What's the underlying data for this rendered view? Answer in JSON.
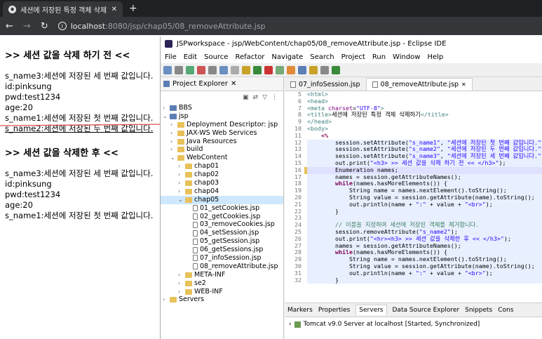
{
  "browser": {
    "tab_title": "세션에 저장된 특정 객체 삭제하",
    "url_host": "localhost",
    "url_rest": ":8080/jsp/chap05/08_removeAttribute.jsp"
  },
  "page": {
    "heading1": ">> 세션 값을 삭제 하기 전 <<",
    "before": [
      "s_name3:세션에 저장된 세 번째 값입니다.",
      "id:pinksung",
      "pwd:test1234",
      "age:20",
      "s_name1:세션에 저장된 첫 번째 값입니다.",
      "s_name2:세션에 저장된 두 번째 값입니다."
    ],
    "heading2": ">> 세션 값을 삭제한 후 <<",
    "after": [
      "s_name3:세션에 저장된 세 번째 값입니다.",
      "id:pinksung",
      "pwd:test1234",
      "age:20",
      "s_name1:세션에 저장된 첫 번째 값입니다."
    ]
  },
  "eclipse": {
    "title": "JSPworkspace - jsp/WebContent/chap05/08_removeAttribute.jsp - Eclipse IDE",
    "menu": [
      "File",
      "Edit",
      "Source",
      "Refactor",
      "Navigate",
      "Search",
      "Project",
      "Run",
      "Window",
      "Help"
    ],
    "project_explorer": "Project Explorer",
    "tree": [
      {
        "label": "BBS",
        "depth": 0,
        "type": "proj",
        "arrow": "›"
      },
      {
        "label": "jsp",
        "depth": 0,
        "type": "proj",
        "arrow": "⌄"
      },
      {
        "label": "Deployment Descriptor: jsp",
        "depth": 1,
        "type": "folder",
        "arrow": "›"
      },
      {
        "label": "JAX-WS Web Services",
        "depth": 1,
        "type": "folder",
        "arrow": "›"
      },
      {
        "label": "Java Resources",
        "depth": 1,
        "type": "folder",
        "arrow": "›"
      },
      {
        "label": "build",
        "depth": 1,
        "type": "folder",
        "arrow": "›"
      },
      {
        "label": "WebContent",
        "depth": 1,
        "type": "folder",
        "arrow": "⌄"
      },
      {
        "label": "chap01",
        "depth": 2,
        "type": "folder",
        "arrow": "›"
      },
      {
        "label": "chap02",
        "depth": 2,
        "type": "folder",
        "arrow": "›"
      },
      {
        "label": "chap03",
        "depth": 2,
        "type": "folder",
        "arrow": "›"
      },
      {
        "label": "chap04",
        "depth": 2,
        "type": "folder",
        "arrow": "›"
      },
      {
        "label": "chap05",
        "depth": 2,
        "type": "folder",
        "arrow": "⌄",
        "selected": true
      },
      {
        "label": "01_setCookies.jsp",
        "depth": 3,
        "type": "file",
        "arrow": ""
      },
      {
        "label": "02_getCookies.jsp",
        "depth": 3,
        "type": "file",
        "arrow": ""
      },
      {
        "label": "03_removeCookies.jsp",
        "depth": 3,
        "type": "file",
        "arrow": ""
      },
      {
        "label": "04_setSession.jsp",
        "depth": 3,
        "type": "file",
        "arrow": ""
      },
      {
        "label": "05_getSession.jsp",
        "depth": 3,
        "type": "file",
        "arrow": ""
      },
      {
        "label": "06_getSessions.jsp",
        "depth": 3,
        "type": "file",
        "arrow": ""
      },
      {
        "label": "07_infoSession.jsp",
        "depth": 3,
        "type": "file",
        "arrow": ""
      },
      {
        "label": "08_removeAttribute.jsp",
        "depth": 3,
        "type": "file",
        "arrow": ""
      },
      {
        "label": "META-INF",
        "depth": 2,
        "type": "folder",
        "arrow": "›"
      },
      {
        "label": "se2",
        "depth": 2,
        "type": "folder",
        "arrow": "›"
      },
      {
        "label": "WEB-INF",
        "depth": 2,
        "type": "folder",
        "arrow": "›"
      },
      {
        "label": "Servers",
        "depth": 0,
        "type": "folder",
        "arrow": "›"
      }
    ],
    "editor_tabs": [
      "07_infoSession.jsp",
      "08_removeAttribute.jsp"
    ],
    "code": [
      {
        "n": "5",
        "h": "<span class='tag'>&lt;html&gt;</span>"
      },
      {
        "n": "6",
        "h": "<span class='tag'>&lt;head&gt;</span>"
      },
      {
        "n": "7",
        "h": "<span class='tag'>&lt;meta </span><span class='attr'>charset</span>=<span class='str'>\"UTF-8\"</span><span class='tag'>&gt;</span>"
      },
      {
        "n": "8",
        "h": "<span class='tag'>&lt;title&gt;</span>세션에 저장된 특정 객체 삭제하기<span class='tag'>&lt;/title&gt;</span>"
      },
      {
        "n": "9",
        "h": "<span class='tag'>&lt;/head&gt;</span>"
      },
      {
        "n": "10",
        "h": "<span class='tag'>&lt;body&gt;</span>"
      },
      {
        "n": "11",
        "h": "    <span class='kw'>&lt;%</span>"
      },
      {
        "n": "12",
        "h": "        session.setAttribute(<span class='str'>\"s_name1\"</span>, <span class='str'>\"세션에 저장된 첫 번째 값입니다.\"</span>);",
        "c": "jsp"
      },
      {
        "n": "13",
        "h": "        session.setAttribute(<span class='str'>\"s_name2\"</span>, <span class='str'>\"세션에 저장된 두 번째 값입니다.\"</span>);",
        "c": "jsp"
      },
      {
        "n": "14",
        "h": "        session.setAttribute(<span class='str'>\"s_name3\"</span>, <span class='str'>\"세션에 저장된 세 번째 값입니다.\"</span>);",
        "c": "jsp"
      },
      {
        "n": "15",
        "h": "        out.print(<span class='str'>\"&lt;h3&gt; &gt;&gt; 세션 값을 삭제 하기 전 &lt;&lt; &lt;/h3&gt;\"</span>);",
        "c": "jsp"
      },
      {
        "n": "16",
        "h": "        Enumeration names;",
        "c": "hl"
      },
      {
        "n": "17",
        "h": "        names = session.getAttributeNames();",
        "c": "jsp"
      },
      {
        "n": "18",
        "h": "        <span class='kw'>while</span>(names.hasMoreElements()) {",
        "c": "jsp"
      },
      {
        "n": "19",
        "h": "            String name = names.nextElement().toString();",
        "c": "jsp"
      },
      {
        "n": "20",
        "h": "            String value = session.getAttribute(name).toString();",
        "c": "jsp"
      },
      {
        "n": "21",
        "h": "            out.println(name + <span class='str'>\":\"</span> + value + <span class='str'>\"&lt;br&gt;\"</span>);",
        "c": "jsp"
      },
      {
        "n": "22",
        "h": "        }",
        "c": "jsp"
      },
      {
        "n": "23",
        "h": "",
        "c": "jsp"
      },
      {
        "n": "24",
        "h": "        <span class='cmt'>// 이름을 지정하여 세션에 저장된 객체를 제거합니다.</span>",
        "c": "jsp"
      },
      {
        "n": "25",
        "h": "        session.removeAttribute(<span class='str'>\"s_name2\"</span>);",
        "c": "jsp"
      },
      {
        "n": "26",
        "h": "        out.print(<span class='str'>\"&lt;hr&gt;&lt;h3&gt; &gt;&gt; 세션 값을 삭제한 후 &lt;&lt; &lt;/h3&gt;\"</span>);",
        "c": "jsp"
      },
      {
        "n": "27",
        "h": "        names = session.getAttributeNames();",
        "c": "jsp"
      },
      {
        "n": "28",
        "h": "        <span class='kw'>while</span>(names.hasMoreElements()) {",
        "c": "jsp"
      },
      {
        "n": "29",
        "h": "            String name = names.nextElement().toString();",
        "c": "jsp"
      },
      {
        "n": "30",
        "h": "            String value = session.getAttribute(name).toString();",
        "c": "jsp"
      },
      {
        "n": "31",
        "h": "            out.println(name + <span class='str'>\":\"</span> + value + <span class='str'>\"&lt;br&gt;\"</span>);",
        "c": "jsp"
      },
      {
        "n": "32",
        "h": "        }",
        "c": "jsp"
      }
    ],
    "bottom_tabs": [
      "Markers",
      "Properties",
      "Servers",
      "Data Source Explorer",
      "Snippets",
      "Cons"
    ],
    "server_status": "Tomcat v9.0 Server at localhost  [Started, Synchronized]"
  }
}
